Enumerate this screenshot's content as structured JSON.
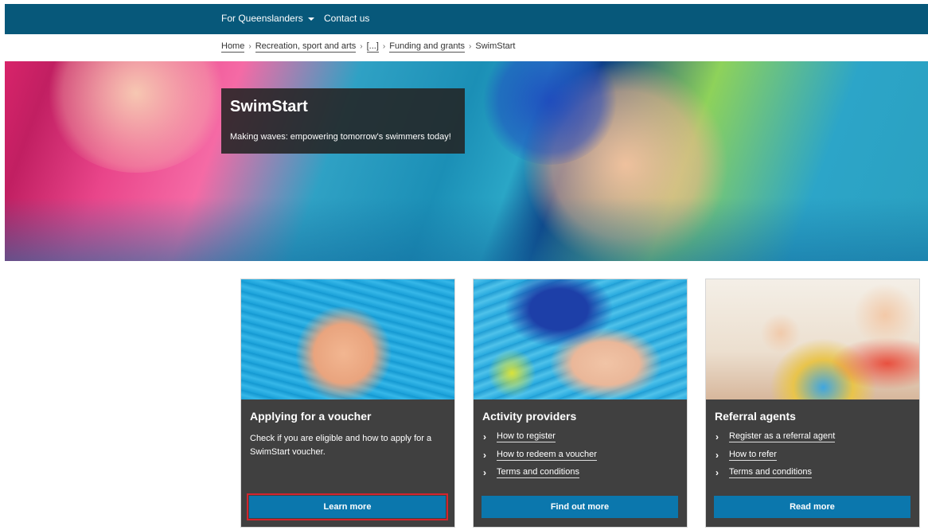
{
  "topnav": {
    "for_queenslanders": "For Queenslanders",
    "contact": "Contact us"
  },
  "breadcrumb": {
    "home": "Home",
    "recreation": "Recreation, sport and arts",
    "ellipsis": "[...]",
    "funding": "Funding and grants",
    "current": "SwimStart"
  },
  "hero": {
    "title": "SwimStart",
    "subtitle": "Making waves: empowering tomorrow's swimmers today!"
  },
  "cards": [
    {
      "title": "Applying for a voucher",
      "description": "Check if you are eligible and how to apply for a SwimStart voucher.",
      "button": "Learn more"
    },
    {
      "title": "Activity providers",
      "links": [
        "How to register",
        "How to redeem a voucher",
        "Terms and conditions"
      ],
      "button": "Find out more"
    },
    {
      "title": "Referral agents",
      "links": [
        "Register as a referral agent",
        "How to refer",
        "Terms and conditions"
      ],
      "button": "Read more"
    }
  ],
  "colors": {
    "nav_bg": "#07587a",
    "button_bg": "#0b77ad",
    "card_bg": "#404040",
    "highlight": "#d4242d"
  },
  "icons": [
    "caret-down-icon",
    "chevron-right-icon"
  ]
}
